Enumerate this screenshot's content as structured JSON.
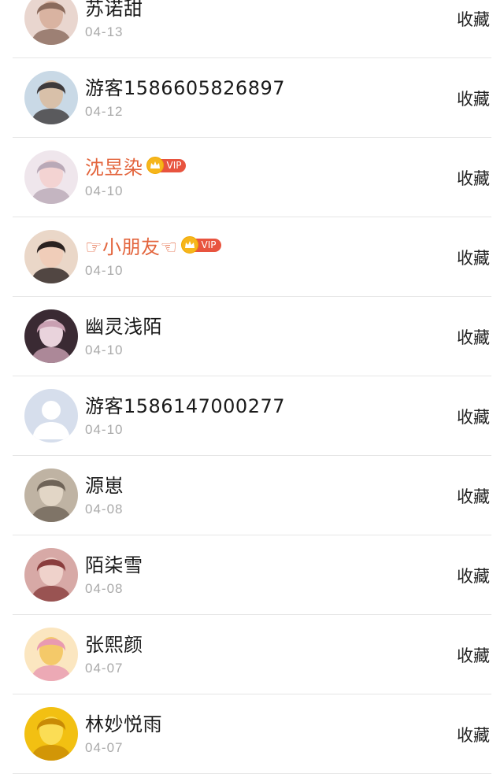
{
  "action_label": "收藏",
  "vip_label": "VIP",
  "rows": [
    {
      "name": "苏诺甜",
      "date": "04-13",
      "vip": false,
      "avatar_colors": [
        "#e9d6cf",
        "#8a6a5c",
        "#d9b3a1"
      ]
    },
    {
      "name": "游客1586605826897",
      "date": "04-12",
      "vip": false,
      "avatar_colors": [
        "#c9d9e6",
        "#3e3a3b",
        "#d8c0a9"
      ]
    },
    {
      "name": "沈昱染",
      "date": "04-10",
      "vip": true,
      "avatar_colors": [
        "#efe6ec",
        "#b9a9b7",
        "#f3d3d2"
      ]
    },
    {
      "name": "☞小朋友☜",
      "date": "04-10",
      "vip": true,
      "avatar_colors": [
        "#ead7c8",
        "#2b2220",
        "#f0cdb9"
      ]
    },
    {
      "name": "幽灵浅陌",
      "date": "04-10",
      "vip": false,
      "avatar_colors": [
        "#3a2a33",
        "#c9a0b2",
        "#e9d3dc"
      ]
    },
    {
      "name": "游客1586147000277",
      "date": "04-10",
      "vip": false,
      "avatar_colors": [
        "#d6deec",
        "#ffffff",
        "#c5cfe2"
      ]
    },
    {
      "name": "源崽",
      "date": "04-08",
      "vip": false,
      "avatar_colors": [
        "#bfb3a3",
        "#6f6458",
        "#e2d6c6"
      ]
    },
    {
      "name": "陌柒雪",
      "date": "04-08",
      "vip": false,
      "avatar_colors": [
        "#d7a9a6",
        "#8a3d3d",
        "#efd2cb"
      ]
    },
    {
      "name": "张熙颜",
      "date": "04-07",
      "vip": false,
      "avatar_colors": [
        "#fbe6c0",
        "#e99ab1",
        "#f4c969"
      ]
    },
    {
      "name": "林妙悦雨",
      "date": "04-07",
      "vip": false,
      "avatar_colors": [
        "#f2c012",
        "#c98b05",
        "#fbdd55"
      ]
    }
  ]
}
